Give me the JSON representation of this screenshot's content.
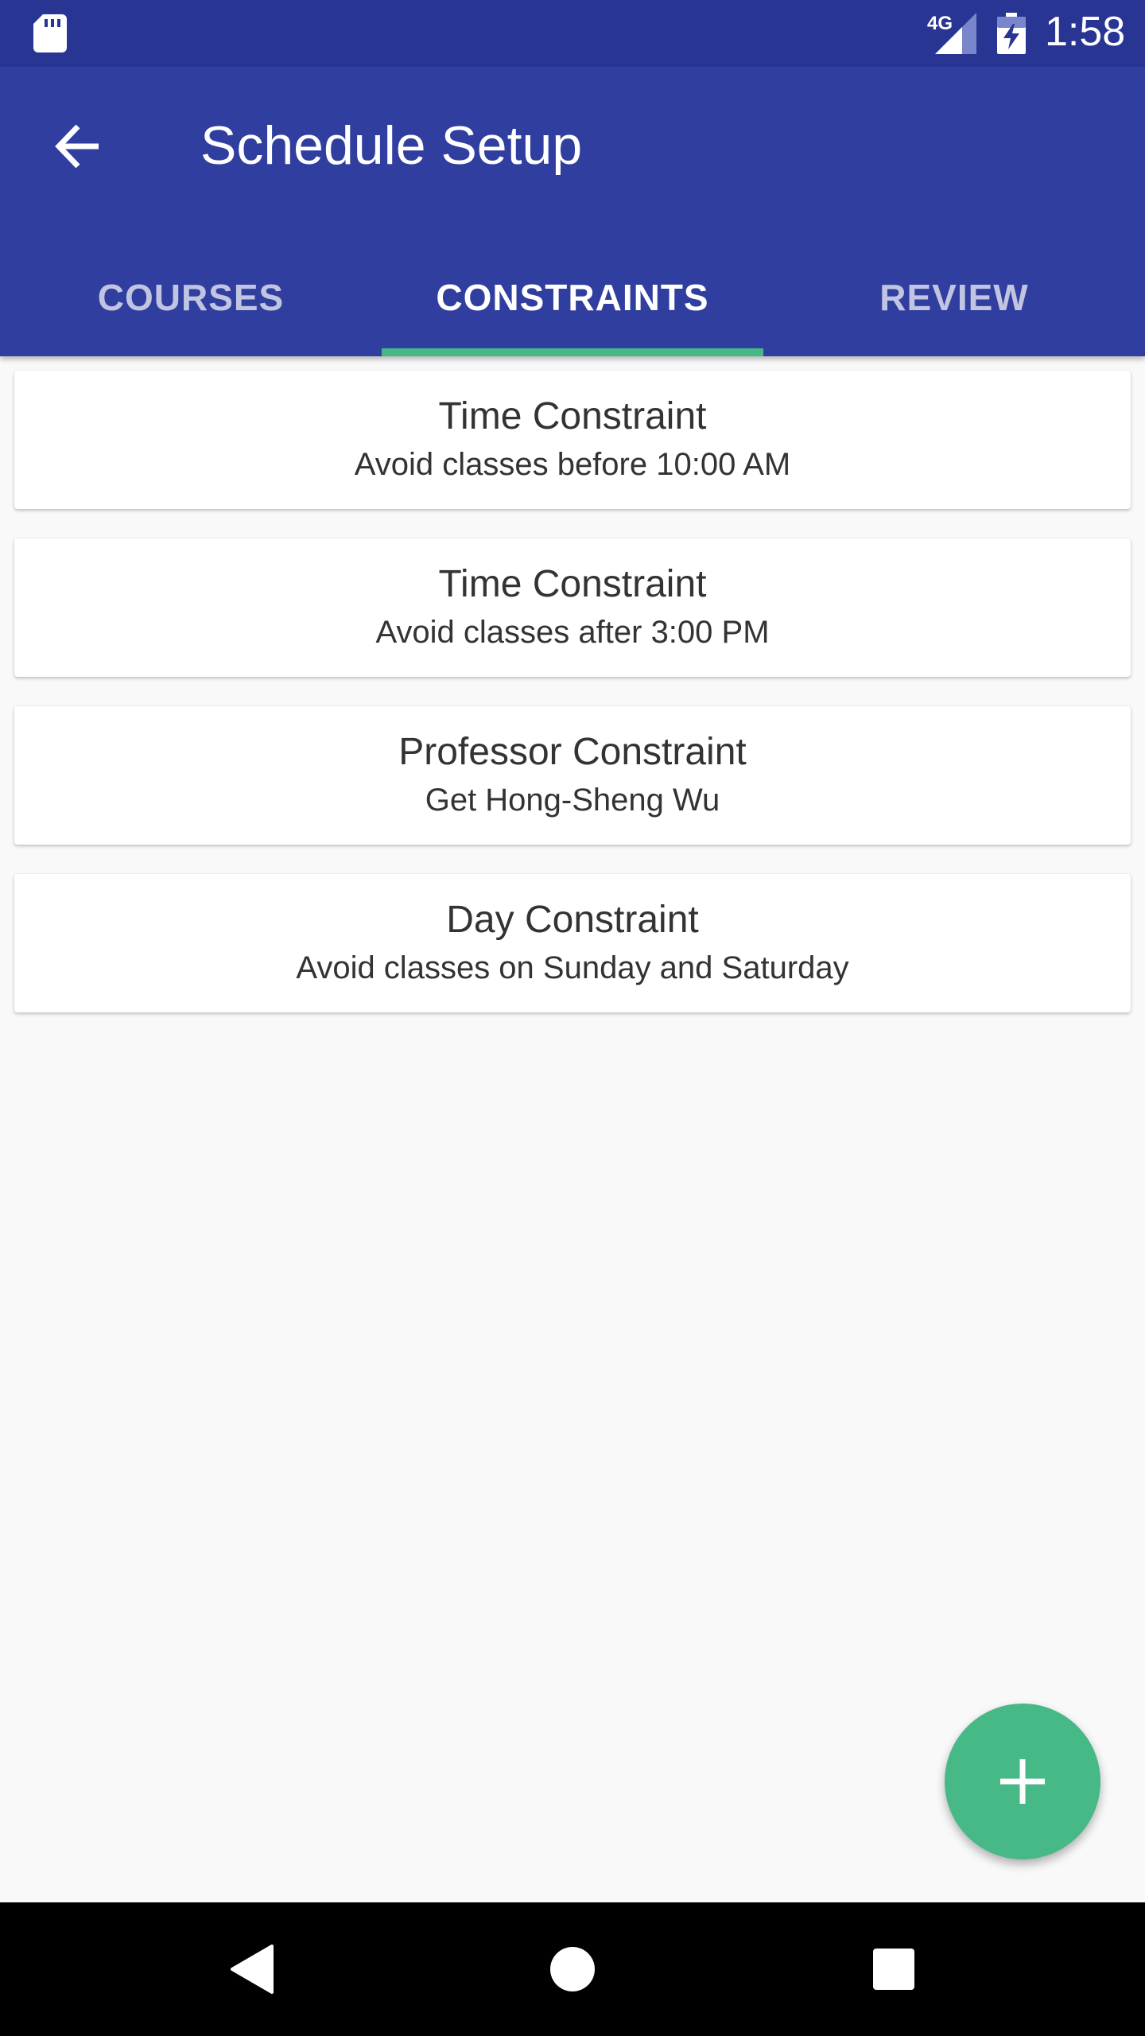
{
  "status_bar": {
    "network_type": "4G",
    "time": "1:58",
    "icons": [
      "sd-card-icon",
      "signal-icon",
      "battery-charging-icon"
    ]
  },
  "app_bar": {
    "title": "Schedule Setup",
    "back_icon": "arrow-back-icon",
    "color": "#303f9f"
  },
  "tabs": [
    {
      "label": "COURSES",
      "active": false
    },
    {
      "label": "CONSTRAINTS",
      "active": true
    },
    {
      "label": "REVIEW",
      "active": false
    }
  ],
  "accent_color": "#46b987",
  "constraints": [
    {
      "title": "Time Constraint",
      "detail": "Avoid classes before 10:00 AM"
    },
    {
      "title": "Time Constraint",
      "detail": "Avoid classes after 3:00 PM"
    },
    {
      "title": "Professor Constraint",
      "detail": "Get Hong-Sheng Wu"
    },
    {
      "title": "Day Constraint",
      "detail": "Avoid classes on Sunday and Saturday"
    }
  ],
  "fab": {
    "icon": "plus-icon"
  },
  "nav_bar": {
    "icons": [
      "back-triangle-icon",
      "home-circle-icon",
      "recents-square-icon"
    ]
  }
}
